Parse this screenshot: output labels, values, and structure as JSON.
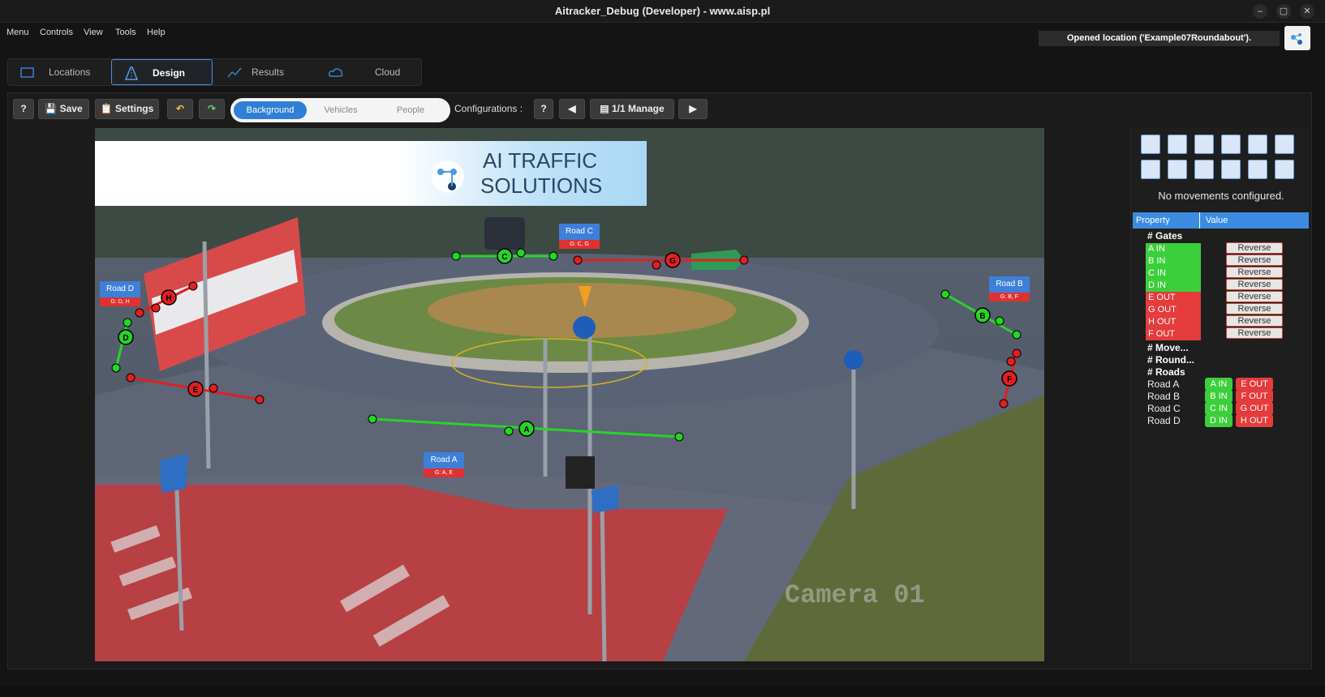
{
  "window": {
    "title": "Aitracker_Debug (Developer) - www.aisp.pl"
  },
  "menu": [
    "Menu",
    "Controls",
    "View",
    "Tools",
    "Help"
  ],
  "status": "Opened location ('Example07Roundabout').",
  "main_tabs": [
    {
      "label": "Locations"
    },
    {
      "label": "Design"
    },
    {
      "label": "Results"
    },
    {
      "label": "Cloud"
    }
  ],
  "toolbar": {
    "help": "?",
    "save": "Save",
    "settings": "Settings",
    "layers": [
      "Background",
      "Vehicles",
      "People"
    ],
    "configurations_label": "Configurations :",
    "cfg_help": "?",
    "manage": "1/1 Manage"
  },
  "banner": {
    "line1": "AI TRAFFIC",
    "line2": "SOLUTIONS"
  },
  "camera_watermark": "Camera 01",
  "roads_overlay": [
    {
      "name": "Road A",
      "gates": "G: A, E"
    },
    {
      "name": "Road B",
      "gates": "G: B, F"
    },
    {
      "name": "Road C",
      "gates": "G: C, G"
    },
    {
      "name": "Road D",
      "gates": "G: D, H"
    }
  ],
  "gate_markers": [
    "A",
    "B",
    "C",
    "D",
    "E",
    "F",
    "G",
    "H"
  ],
  "right_panel": {
    "no_movements": "No movements configured.",
    "headers": {
      "property": "Property",
      "value": "Value"
    },
    "sections": {
      "gates": "# Gates",
      "movements": "# Move...",
      "roundabouts": "# Round...",
      "roads": "# Roads"
    },
    "gates": [
      {
        "name": "A IN",
        "color": "#3ccf3c",
        "action": "Reverse"
      },
      {
        "name": "B IN",
        "color": "#3ccf3c",
        "action": "Reverse"
      },
      {
        "name": "C IN",
        "color": "#3ccf3c",
        "action": "Reverse"
      },
      {
        "name": "D IN",
        "color": "#3ccf3c",
        "action": "Reverse"
      },
      {
        "name": "E OUT",
        "color": "#e63b3b",
        "action": "Reverse"
      },
      {
        "name": "G OUT",
        "color": "#e63b3b",
        "action": "Reverse"
      },
      {
        "name": "H OUT",
        "color": "#e63b3b",
        "action": "Reverse"
      },
      {
        "name": "F OUT",
        "color": "#e63b3b",
        "action": "Reverse"
      }
    ],
    "roads": [
      {
        "name": "Road A",
        "in": "A IN",
        "out": "E OUT"
      },
      {
        "name": "Road B",
        "in": "B IN",
        "out": "F OUT"
      },
      {
        "name": "Road C",
        "in": "C IN",
        "out": "G OUT"
      },
      {
        "name": "Road D",
        "in": "D IN",
        "out": "H OUT"
      }
    ]
  },
  "colors": {
    "accent": "#2f7fd6",
    "in": "#3ccf3c",
    "out": "#e63b3b"
  }
}
